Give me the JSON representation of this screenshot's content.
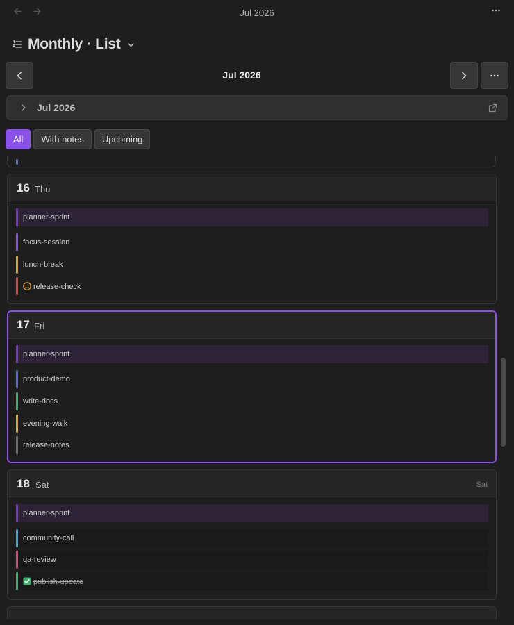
{
  "titlebar": {
    "back_icon": "arrow-left-icon",
    "forward_icon": "arrow-right-icon",
    "title": "Jul 2026",
    "more_icon": "more-horizontal-icon"
  },
  "view": {
    "icon": "list-ordered-icon",
    "title": "Monthly · List",
    "dropdown_icon": "chevron-down-icon"
  },
  "nav": {
    "prev_icon": "chevron-left-icon",
    "next_icon": "chevron-right-icon",
    "more_icon": "more-horizontal-icon",
    "period": "Jul 2026"
  },
  "month_bar": {
    "expand_icon": "chevron-right-icon",
    "label": "Jul 2026",
    "open_icon": "external-link-icon"
  },
  "filters": [
    {
      "label": "All",
      "active": true
    },
    {
      "label": "With notes",
      "active": false
    },
    {
      "label": "Upcoming",
      "active": false
    }
  ],
  "days": [
    {
      "num": "16",
      "name": "Thu",
      "right": "",
      "events": [
        {
          "text": "planner-sprint",
          "color": "#7b2fd6",
          "style": "hl"
        },
        {
          "text": "focus-session",
          "color": "#8a52e8",
          "style": ""
        },
        {
          "text": "lunch-break",
          "color": "#e0a732",
          "style": ""
        },
        {
          "text": "release-check",
          "color": "#d9473a",
          "style": "",
          "icon": "smiley-face-icon"
        }
      ]
    },
    {
      "num": "17",
      "name": "Fri",
      "right": "",
      "selected": true,
      "events": [
        {
          "text": "planner-sprint",
          "color": "#7b2fd6",
          "style": "hl"
        },
        {
          "text": "product-demo",
          "color": "#4f6fd6",
          "style": ""
        },
        {
          "text": "write-docs",
          "color": "#3fb06c",
          "style": ""
        },
        {
          "text": "evening-walk",
          "color": "#e0a732",
          "style": ""
        },
        {
          "text": "release-notes",
          "color": "#6d6d6d",
          "style": ""
        }
      ]
    },
    {
      "num": "18",
      "name": "Sat",
      "right": "Sat",
      "events": [
        {
          "text": "planner-sprint",
          "color": "#7b2fd6",
          "style": "hl"
        },
        {
          "text": "community-call",
          "color": "#3aa6d6",
          "style": "shade"
        },
        {
          "text": "qa-review",
          "color": "#d6487e",
          "style": "shade"
        },
        {
          "text": "publish-update",
          "color": "#3fb06c",
          "style": "shade",
          "icon": "check-box-icon",
          "done": true
        }
      ]
    }
  ],
  "colors": {
    "accent": "#8a52e8",
    "background": "#1e1e1e"
  }
}
